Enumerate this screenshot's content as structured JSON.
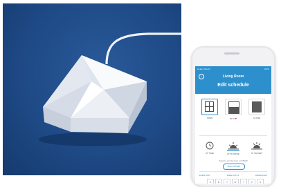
{
  "colors": {
    "accent": "#2d90cc",
    "photo_bg": "#1e4a86",
    "heart": "#d8312d"
  },
  "phone": {
    "status": {
      "carrier": "●●●●● Sketch",
      "time": "9:41 AM",
      "battery": "100%"
    },
    "room_title": "Living Room",
    "back_icon": "back-arrow-icon",
    "screen_title": "Edit schedule",
    "positions": [
      {
        "label": "OPEN",
        "icon": "window-open-icon",
        "selected": true
      },
      {
        "label": "50 %",
        "icon": "half-shade-icon",
        "heart": "♥"
      },
      {
        "label": "CLOSE",
        "icon": "closed-shade-icon"
      }
    ],
    "triggers": [
      {
        "label": "AT TIME",
        "icon": "clock-icon"
      },
      {
        "label": "AT SUNRISE",
        "icon": "sunrise-icon",
        "selected": true
      },
      {
        "label": "AT SUNSET",
        "icon": "sunset-icon"
      }
    ],
    "hint": "Select a sunrise time or DRAW",
    "add_button": "ADD OFFSET",
    "day_tabs": [
      "EVERYDAY",
      "WEEK DAYS",
      "WEEKENDS"
    ],
    "weekdays": [
      "S",
      "M",
      "T",
      "W",
      "T",
      "F",
      "S"
    ]
  }
}
